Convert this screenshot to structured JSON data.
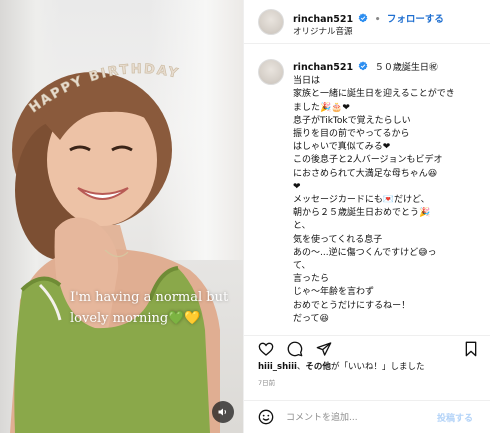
{
  "video": {
    "overlay_lines": [
      "I'm having a normal but",
      "lovely morning💚💛"
    ],
    "crown_text": "HAPPY BIRTHDAY"
  },
  "header": {
    "username": "rinchan521",
    "separator": "•",
    "follow_label": "フォローする",
    "audio_label": "オリジナル音源"
  },
  "caption": {
    "username": "rinchan521",
    "title": "５０歳誕生日㊗",
    "lines": [
      "当日は",
      "家族と一緒に誕生日を迎えることができ",
      "ました🎉🎂❤",
      "息子がTikTokで覚えたらしい",
      "振りを目の前でやってるから",
      "はしゃいで真似てみる❤",
      "この後息子と2人バージョンもビデオ",
      "におさめられて大満足な母ちゃん😆",
      "❤",
      "メッセージカードにも💌だけど、",
      "朝から２５歳誕生日おめでとう🎉",
      "と、",
      "気を使ってくれる息子",
      "あの〜...逆に傷つくんですけど😅っ",
      "て、",
      "言ったら",
      "じゃ〜年齢を言わず",
      "おめでとうだけにするねー！",
      "だって😆"
    ]
  },
  "likes": {
    "user": "hiii_shiii",
    "text_a": "、",
    "others": "その他",
    "text_b": "が「いいね！」しました"
  },
  "date": "7日前",
  "comment": {
    "placeholder": "コメントを追加...",
    "post_label": "投稿する"
  },
  "colors": {
    "accent": "#1f6fd0",
    "post_disabled": "#b3d3f8",
    "tank_top": "#8aa84a"
  },
  "icons": {
    "header_more": "more-dots-icon",
    "like": "heart-icon",
    "comment": "comment-icon",
    "share": "send-icon",
    "save": "bookmark-icon",
    "emoji": "smiley-icon",
    "sound": "speaker-icon"
  }
}
